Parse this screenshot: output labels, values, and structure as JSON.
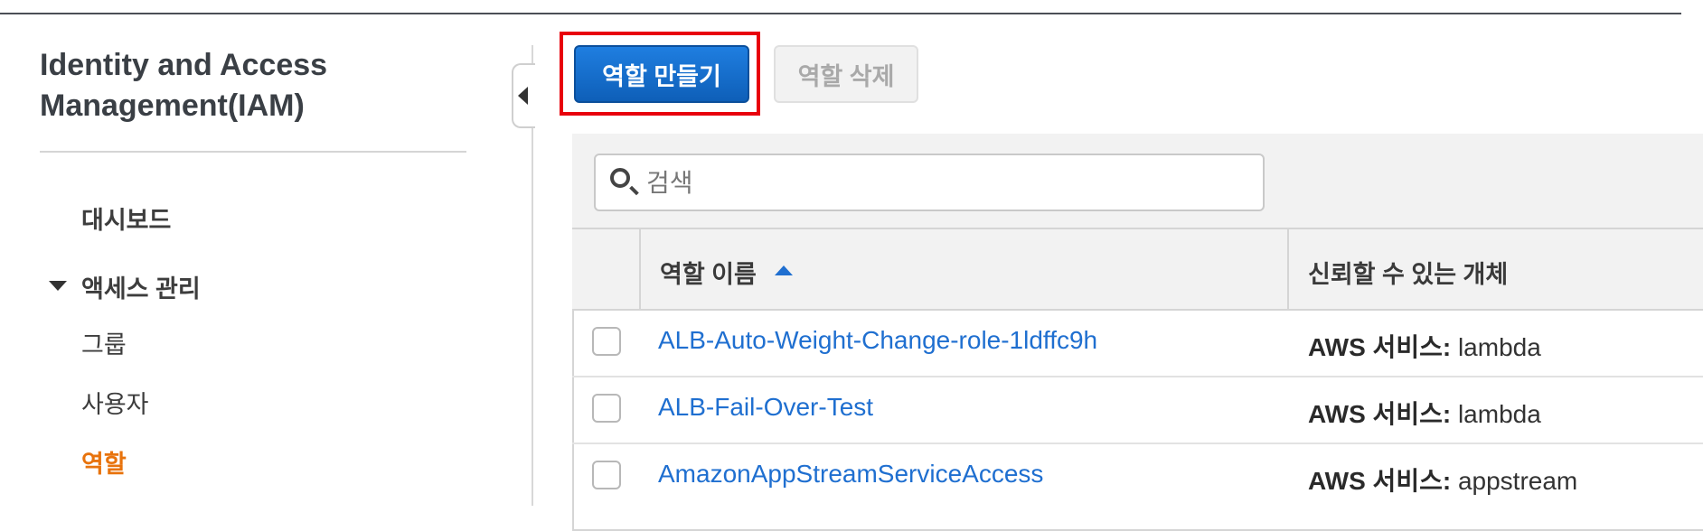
{
  "sidebar": {
    "title_line1": "Identity and Access",
    "title_line2": "Management(IAM)",
    "dashboard": "대시보드",
    "access_management": "액세스 관리",
    "groups": "그룹",
    "users": "사용자",
    "roles": "역할"
  },
  "toolbar": {
    "create_role": "역할 만들기",
    "delete_role": "역할 삭제"
  },
  "search": {
    "placeholder": "검색"
  },
  "table": {
    "col_role_name": "역할 이름",
    "col_trusted_entity": "신뢰할 수 있는 개체",
    "rows": [
      {
        "name": "ALB-Auto-Weight-Change-role-1ldffc9h",
        "trust_prefix": "AWS 서비스:",
        "trust_value": "lambda"
      },
      {
        "name": "ALB-Fail-Over-Test",
        "trust_prefix": "AWS 서비스:",
        "trust_value": "lambda"
      },
      {
        "name": "AmazonAppStreamServiceAccess",
        "trust_prefix": "AWS 서비스:",
        "trust_value": "appstream"
      }
    ]
  },
  "colors": {
    "primary_button": "#1068c9",
    "link": "#1f6fd0",
    "active_nav": "#e8730c",
    "highlight_box": "#e8000c"
  }
}
